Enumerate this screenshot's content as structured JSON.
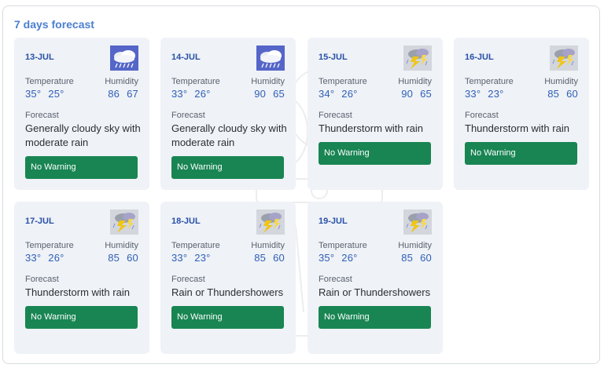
{
  "panel": {
    "title": "7 days forecast",
    "labels": {
      "temperature": "Temperature",
      "humidity": "Humidity",
      "forecast": "Forecast"
    }
  },
  "colors": {
    "title": "#4a7fd0",
    "date": "#2750a8",
    "value": "#2f5fb8",
    "card_bg": "#eff2f6",
    "warning_bg": "#188553"
  },
  "days": [
    {
      "date": "13-JUL",
      "icon": "moderate-rain-cloud-icon",
      "temp_max": "35°",
      "temp_min": "25°",
      "hum_max": "86",
      "hum_min": "67",
      "forecast": "Generally cloudy sky with moderate rain",
      "warning": "No Warning"
    },
    {
      "date": "14-JUL",
      "icon": "moderate-rain-cloud-icon",
      "temp_max": "33°",
      "temp_min": "26°",
      "hum_max": "90",
      "hum_min": "65",
      "forecast": "Generally cloudy sky with moderate rain",
      "warning": "No Warning"
    },
    {
      "date": "15-JUL",
      "icon": "thunderstorm-icon",
      "temp_max": "34°",
      "temp_min": "26°",
      "hum_max": "90",
      "hum_min": "65",
      "forecast": "Thunderstorm with rain",
      "warning": "No Warning"
    },
    {
      "date": "16-JUL",
      "icon": "thunderstorm-icon",
      "temp_max": "33°",
      "temp_min": "23°",
      "hum_max": "85",
      "hum_min": "60",
      "forecast": "Thunderstorm with rain",
      "warning": "No Warning"
    },
    {
      "date": "17-JUL",
      "icon": "thunderstorm-icon",
      "temp_max": "33°",
      "temp_min": "26°",
      "hum_max": "85",
      "hum_min": "60",
      "forecast": "Thunderstorm with rain",
      "warning": "No Warning"
    },
    {
      "date": "18-JUL",
      "icon": "thunderstorm-icon",
      "temp_max": "33°",
      "temp_min": "23°",
      "hum_max": "85",
      "hum_min": "60",
      "forecast": "Rain or Thundershowers",
      "warning": "No Warning"
    },
    {
      "date": "19-JUL",
      "icon": "thunderstorm-icon",
      "temp_max": "35°",
      "temp_min": "26°",
      "hum_max": "85",
      "hum_min": "60",
      "forecast": "Rain or Thundershowers",
      "warning": "No Warning"
    }
  ]
}
